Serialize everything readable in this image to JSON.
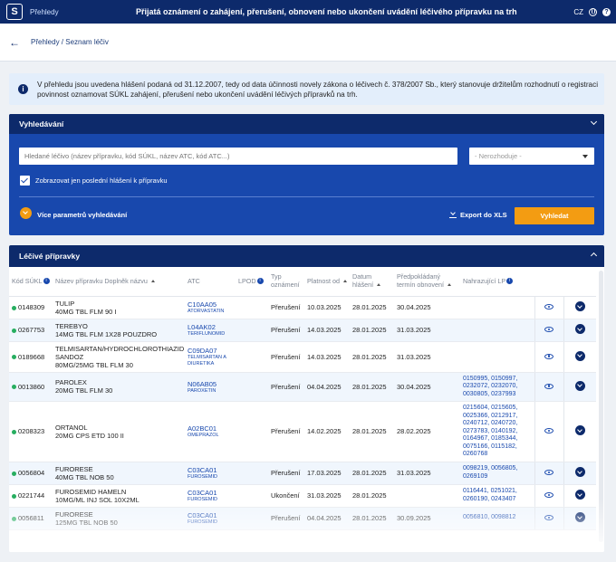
{
  "topbar": {
    "logo": "S",
    "app_name": "Přehledy",
    "title": "Přijatá oznámení o zahájení, přerušení, obnovení nebo ukončení uvádění léčivého přípravku na trh",
    "lang": "CZ"
  },
  "breadcrumb": {
    "text": "Přehledy / Seznam léčiv"
  },
  "info": {
    "icon": "i",
    "text": "V přehledu jsou uvedena hlášení podaná od 31.12.2007, tedy od data účinnosti novely zákona o léčivech č. 378/2007 Sb., který stanovuje držitelům rozhodnutí o registraci povinnost oznamovat SÚKL zahájení, přerušení nebo ukončení uvádění léčivých přípravků na trh."
  },
  "search": {
    "title": "Vyhledávání",
    "input_placeholder": "Hledané léčivo (název přípravku, kód SÚKL, název ATC, kód ATC...)",
    "select_value": "- Nerozhoduje -",
    "checkbox_label": "Zobrazovat jen poslední hlášení k přípravku",
    "more_params": "Více parametrů vyhledávání",
    "export": "Export do XLS",
    "search_button": "Vyhledat"
  },
  "results": {
    "title": "Léčivé přípravky",
    "columns": {
      "code": "Kód SÚKL",
      "name": "Název přípravku Doplněk názvu",
      "atc": "ATC",
      "lpod": "LPOD",
      "type": "Typ oznámení",
      "valid_from": "Platnost od",
      "reported": "Datum hlášení",
      "expected": "Předpokládaný termín obnovení",
      "replacing": "Nahrazující LP"
    },
    "rows": [
      {
        "code": "0148309",
        "name": "TULIP",
        "detail": "40MG TBL FLM 90 I",
        "atc": "C10AA05",
        "atc_name": "ATORVASTATIN",
        "type": "Přerušení",
        "valid": "10.03.2025",
        "reported": "28.01.2025",
        "expected": "30.04.2025",
        "replacing": ""
      },
      {
        "code": "0267753",
        "name": "TEREBYO",
        "detail": "14MG TBL FLM 1X28 POUZDRO",
        "atc": "L04AK02",
        "atc_name": "TERIFLUNOMID",
        "type": "Přerušení",
        "valid": "14.03.2025",
        "reported": "28.01.2025",
        "expected": "31.03.2025",
        "replacing": ""
      },
      {
        "code": "0189668",
        "name": "TELMISARTAN/HYDROCHLOROTHIAZID SANDOZ",
        "detail": "80MG/25MG TBL FLM 30",
        "atc": "C09DA07",
        "atc_name": "TELMISARTAN A DIURETIKA",
        "type": "Přerušení",
        "valid": "14.03.2025",
        "reported": "28.01.2025",
        "expected": "31.03.2025",
        "replacing": ""
      },
      {
        "code": "0013860",
        "name": "PAROLEX",
        "detail": "20MG TBL FLM 30",
        "atc": "N06AB05",
        "atc_name": "PAROXETIN",
        "type": "Přerušení",
        "valid": "04.04.2025",
        "reported": "28.01.2025",
        "expected": "30.04.2025",
        "replacing": "0150995, 0150997, 0232072, 0232070, 0030805, 0237993"
      },
      {
        "code": "0208323",
        "name": "ORTANOL",
        "detail": "20MG CPS ETD 100 II",
        "atc": "A02BC01",
        "atc_name": "OMEPRAZOL",
        "type": "Přerušení",
        "valid": "14.02.2025",
        "reported": "28.01.2025",
        "expected": "28.02.2025",
        "replacing": "0215604, 0215605, 0025366, 0212917, 0240712, 0240720, 0273783, 0140192, 0164967, 0185344, 0075166, 0115182, 0260768"
      },
      {
        "code": "0056804",
        "name": "FURORESE",
        "detail": "40MG TBL NOB 50",
        "atc": "C03CA01",
        "atc_name": "FUROSEMID",
        "type": "Přerušení",
        "valid": "17.03.2025",
        "reported": "28.01.2025",
        "expected": "31.03.2025",
        "replacing": "0098219, 0056805, 0269109"
      },
      {
        "code": "0221744",
        "name": "FUROSEMID HAMELN",
        "detail": "10MG/ML INJ SOL 10X2ML",
        "atc": "C03CA01",
        "atc_name": "FUROSEMID",
        "type": "Ukončení",
        "valid": "31.03.2025",
        "reported": "28.01.2025",
        "expected": "",
        "replacing": "0116441, 0251021, 0260190, 0243407"
      },
      {
        "code": "0056811",
        "name": "FURORESE",
        "detail": "125MG TBL NOB 50",
        "atc": "C03CA01",
        "atc_name": "FUROSEMID",
        "type": "Přerušení",
        "valid": "04.04.2025",
        "reported": "28.01.2025",
        "expected": "30.09.2025",
        "replacing": "0056810, 0098812"
      }
    ]
  }
}
